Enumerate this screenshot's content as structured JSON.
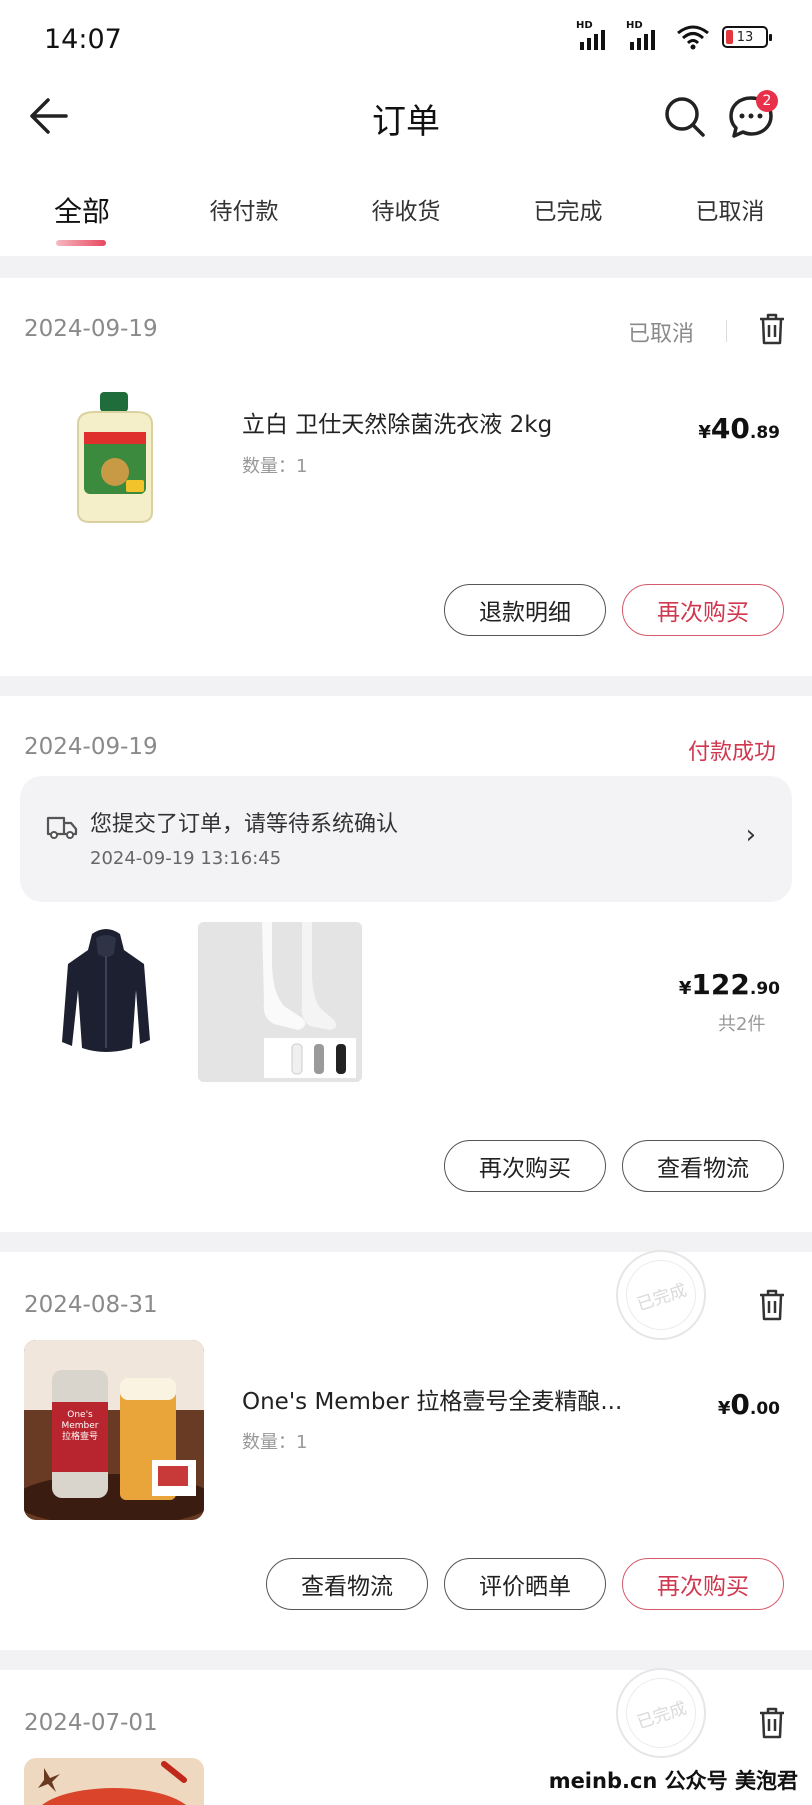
{
  "status_bar": {
    "time": "14:07",
    "signal_1": "HD",
    "signal_2": "HD",
    "battery": "13"
  },
  "header": {
    "title": "订单",
    "message_badge": "2"
  },
  "tabs": [
    {
      "label": "全部",
      "active": true
    },
    {
      "label": "待付款",
      "active": false
    },
    {
      "label": "待收货",
      "active": false
    },
    {
      "label": "已完成",
      "active": false
    },
    {
      "label": "已取消",
      "active": false
    }
  ],
  "orders": [
    {
      "date": "2024-09-19",
      "status": "已取消",
      "product_name": "立白 卫仕天然除菌洗衣液 2kg",
      "quantity": "数量：1",
      "price_symbol": "¥",
      "price_int": "40",
      "price_dec": ".89",
      "buttons": [
        "退款明细",
        "再次购买"
      ]
    },
    {
      "date": "2024-09-19",
      "status": "付款成功",
      "notice_text": "您提交了订单，请等待系统确认",
      "notice_time": "2024-09-19 13:16:45",
      "price_symbol": "¥",
      "price_int": "122",
      "price_dec": ".90",
      "item_count": "共2件",
      "buttons": [
        "再次购买",
        "查看物流"
      ]
    },
    {
      "date": "2024-08-31",
      "stamp": "已完成",
      "product_name": "One's Member 拉格壹号全麦精酿...",
      "quantity": "数量：1",
      "price_symbol": "¥",
      "price_int": "0",
      "price_dec": ".00",
      "can_label": "One's Member 拉格壹号",
      "buttons": [
        "查看物流",
        "评价晒单",
        "再次购买"
      ]
    },
    {
      "date": "2024-07-01",
      "stamp": "已完成"
    }
  ],
  "watermark": "meinb.cn  公众号 美泡君",
  "colors": {
    "accent_red": "#e8304b",
    "status_red": "#d0384f",
    "background": "#f2f2f4"
  }
}
